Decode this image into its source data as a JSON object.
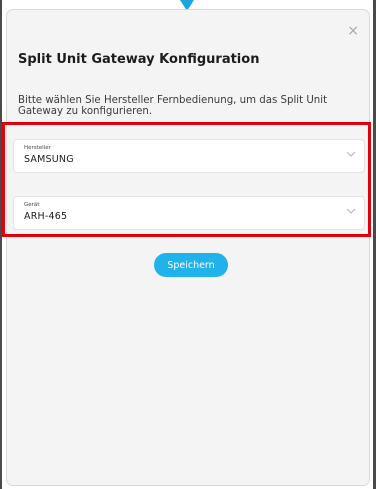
{
  "dialog": {
    "title": "Split Unit Gateway Konfiguration",
    "description": "Bitte wählen Sie Hersteller Fernbedienung, um das Split Unit Gateway zu konfigurieren.",
    "close_glyph": "×"
  },
  "fields": {
    "manufacturer": {
      "label": "Hersteller",
      "value": "SAMSUNG",
      "icon": "chevron-down-icon"
    },
    "device": {
      "label": "Gerät",
      "value": "ARH-465",
      "icon": "chevron-down-icon"
    }
  },
  "actions": {
    "save_label": "Speichern"
  },
  "colors": {
    "accent": "#20b2ea",
    "highlight": "#e0000f",
    "modal_bg": "#f4f4f4",
    "pointer": "#1aa6e0"
  }
}
